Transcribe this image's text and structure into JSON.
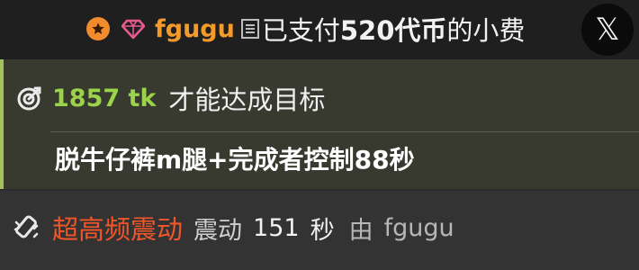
{
  "tip_bar": {
    "icons": [
      "star-badge-icon",
      "diamond-badge-icon",
      "document-icon"
    ],
    "username": "fgugu",
    "text_prefix": "已支付",
    "amount": "520代币",
    "text_suffix": "的小费",
    "colors": {
      "username": "#f39a2b",
      "star_badge": "#f28a2e",
      "diamond": "#e85a8f"
    }
  },
  "close_button": {
    "label": "𝕏",
    "icon": "x-logo-icon"
  },
  "goal": {
    "icon": "target-icon",
    "amount": "1857 tk",
    "text": "才能达成目标",
    "description": "脱牛仔裤m腿+完成者控制88秒",
    "colors": {
      "amount": "#9bd34a",
      "accent_border": "#a4c25a"
    }
  },
  "vibration": {
    "icon": "vibration-icon",
    "level": "超高频震动",
    "word": "震动",
    "duration": "151",
    "unit": "秒",
    "by": "由",
    "username": "fgugu",
    "colors": {
      "level": "#f0562a"
    }
  }
}
